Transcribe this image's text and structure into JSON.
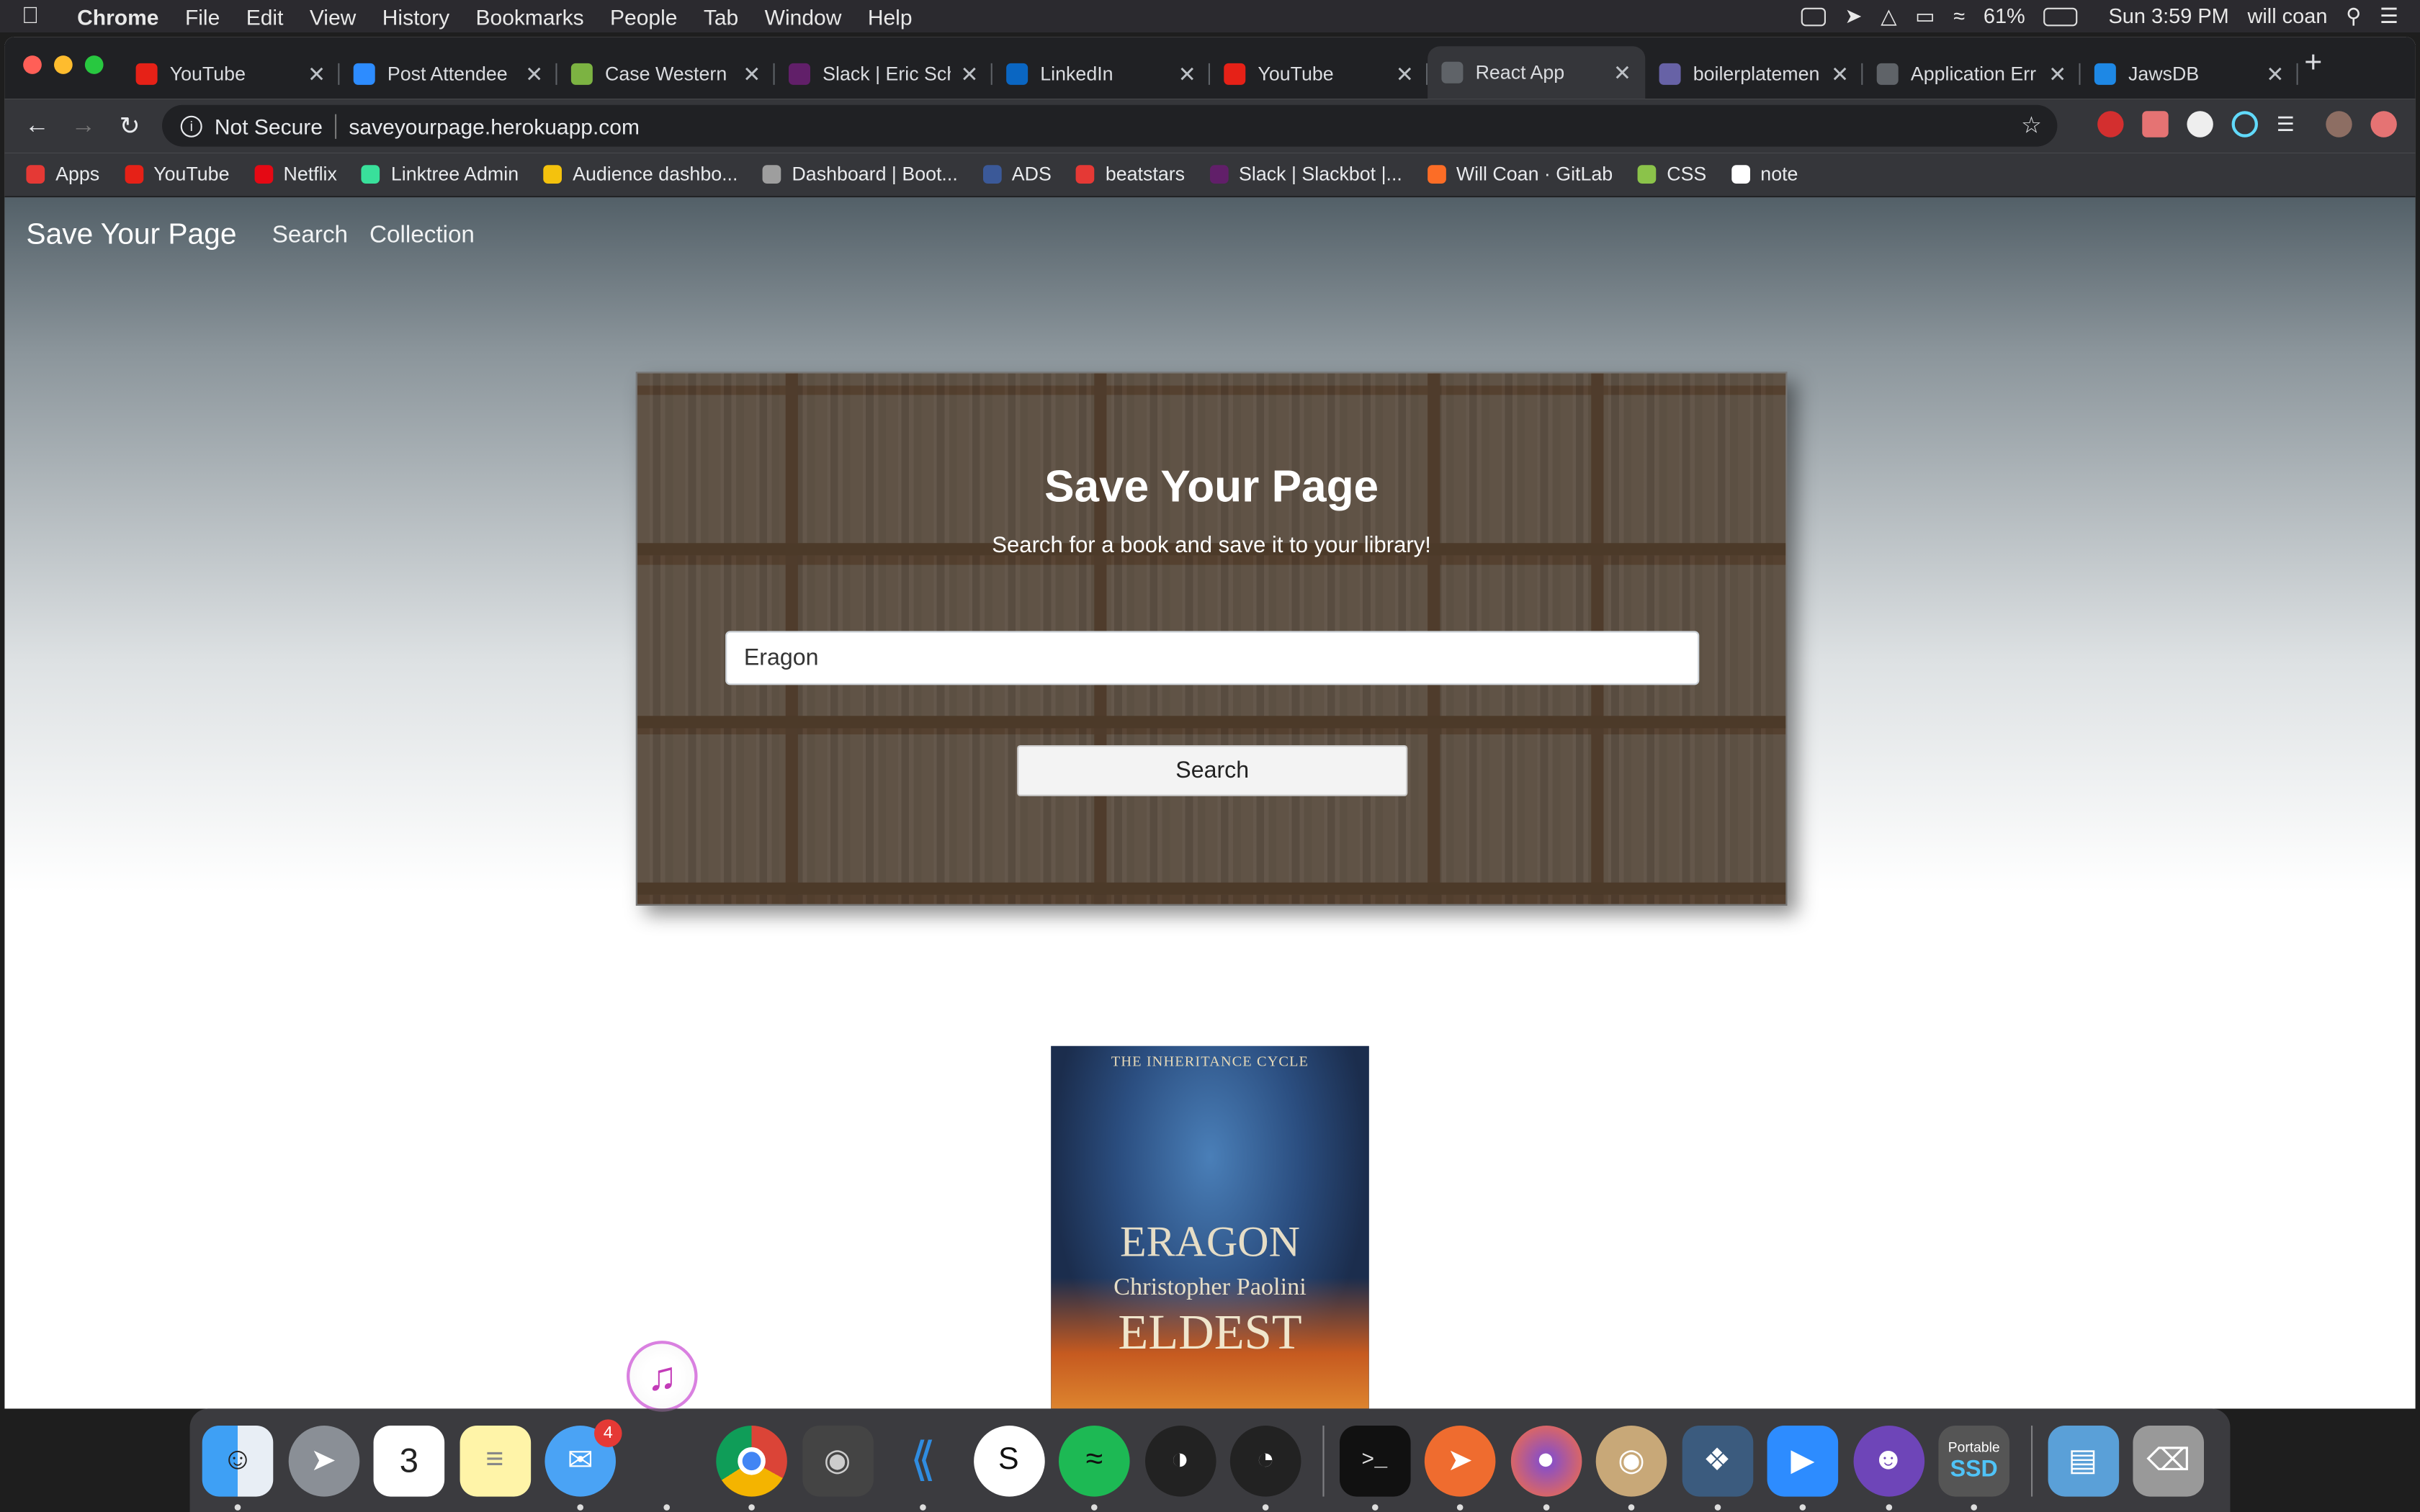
{
  "menubar": {
    "items": [
      "Chrome",
      "File",
      "Edit",
      "View",
      "History",
      "Bookmarks",
      "People",
      "Tab",
      "Window",
      "Help"
    ],
    "battery": "61%",
    "clock": "Sun 3:59 PM",
    "user": "will coan"
  },
  "tabs": [
    {
      "title": "YouTube",
      "icon": "youtube-icon",
      "color": "#e62117"
    },
    {
      "title": "Post Attendee",
      "icon": "zoom-icon",
      "color": "#2d8cff"
    },
    {
      "title": "Case Western R",
      "icon": "sheet-icon",
      "color": "#7cb342"
    },
    {
      "title": "Slack | Eric Sch",
      "icon": "slack-icon",
      "color": "#611f69"
    },
    {
      "title": "LinkedIn",
      "icon": "linkedin-icon",
      "color": "#0a66c2"
    },
    {
      "title": "YouTube",
      "icon": "youtube-icon",
      "color": "#e62117"
    },
    {
      "title": "React App",
      "icon": "globe-icon",
      "color": "#5f6368",
      "active": true
    },
    {
      "title": "boilerplatemen",
      "icon": "heroku-icon",
      "color": "#6762a6"
    },
    {
      "title": "Application Err",
      "icon": "globe-icon",
      "color": "#5f6368"
    },
    {
      "title": "JawsDB",
      "icon": "jawsdb-icon",
      "color": "#1e88e5"
    }
  ],
  "address": {
    "security": "Not Secure",
    "url": "saveyourpage.herokuapp.com"
  },
  "bookmarks": [
    {
      "label": "Apps",
      "icon": "apps-grid-icon",
      "color": "#e53935"
    },
    {
      "label": "YouTube",
      "icon": "youtube-icon",
      "color": "#e62117"
    },
    {
      "label": "Netflix",
      "icon": "netflix-icon",
      "color": "#e50914"
    },
    {
      "label": "Linktree Admin",
      "icon": "linktree-icon",
      "color": "#39e09b"
    },
    {
      "label": "Audience dashbo...",
      "icon": "audience-icon",
      "color": "#f4c20d"
    },
    {
      "label": "Dashboard | Boot...",
      "icon": "bootcamp-icon",
      "color": "#9e9e9e"
    },
    {
      "label": "ADS",
      "icon": "facebook-icon",
      "color": "#3b5998"
    },
    {
      "label": "beatstars",
      "icon": "beatstars-icon",
      "color": "#e53935"
    },
    {
      "label": "Slack | Slackbot |...",
      "icon": "slack-icon",
      "color": "#611f69"
    },
    {
      "label": "Will Coan · GitLab",
      "icon": "gitlab-icon",
      "color": "#fc6d26"
    },
    {
      "label": "CSS",
      "icon": "css-icon",
      "color": "#8bc34a"
    },
    {
      "label": "note",
      "icon": "google-icon",
      "color": "#ffffff"
    }
  ],
  "nav": {
    "brand": "Save Your Page",
    "links": [
      "Search",
      "Collection"
    ]
  },
  "hero": {
    "title": "Save Your Page",
    "subtitle": "Search for a book and save it to your library!",
    "search_value": "Eragon",
    "search_button": "Search"
  },
  "result": {
    "cover_series": "THE INHERITANCE CYCLE",
    "cover_title": "ERAGON",
    "cover_author": "Christopher Paolini",
    "cover_subtitle": "ELDEST"
  },
  "dock": {
    "messages_badge": "4",
    "ssd_label_top": "Portable",
    "ssd_label_bottom": "SSD"
  }
}
